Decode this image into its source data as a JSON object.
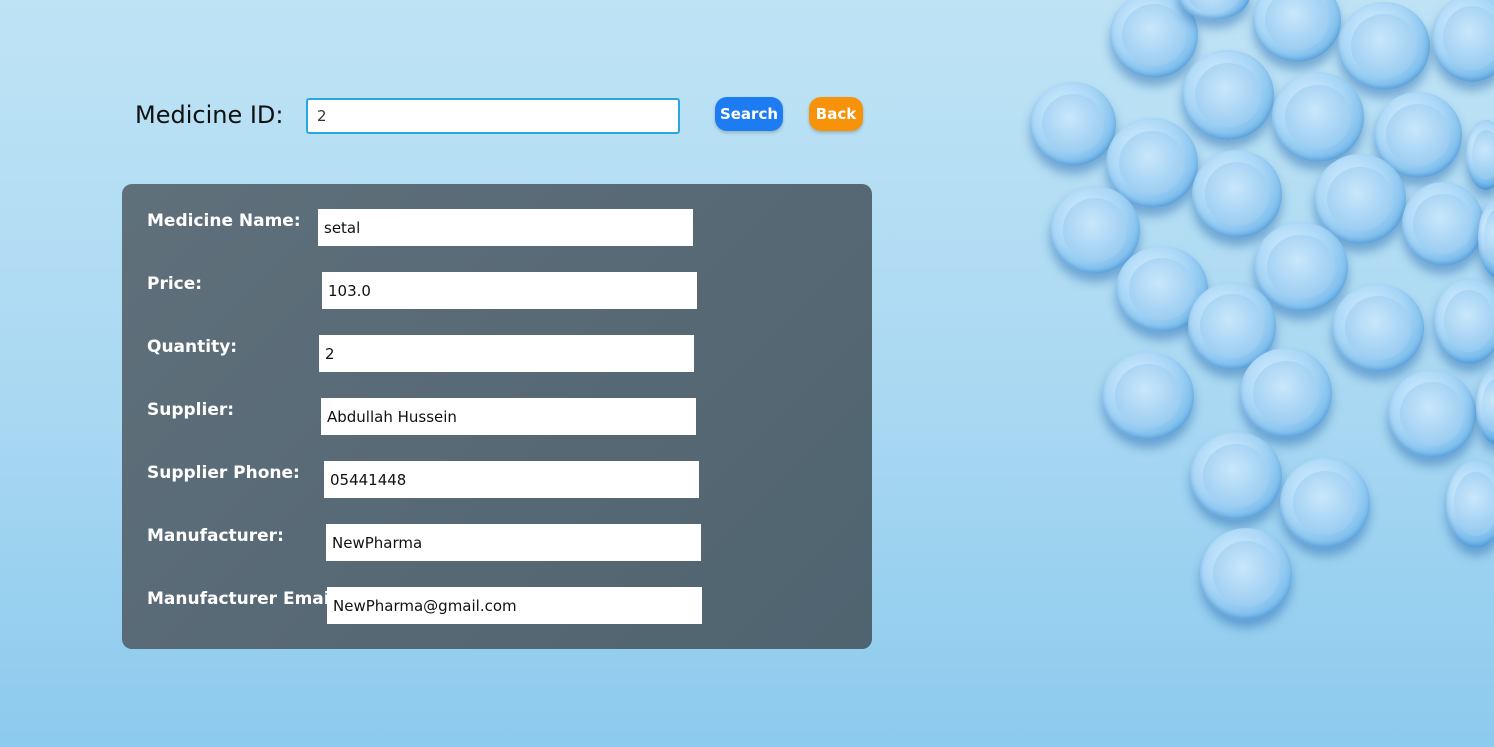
{
  "search": {
    "label": "Medicine ID:",
    "value": "2",
    "search_button": "Search",
    "back_button": "Back"
  },
  "details": {
    "name_label": "Medicine Name:",
    "name_value": "setal",
    "price_label": "Price:",
    "price_value": "103.0",
    "quantity_label": "Quantity:",
    "quantity_value": "2",
    "supplier_label": "Supplier:",
    "supplier_value": "Abdullah Hussein",
    "supplier_phone_label": "Supplier Phone:",
    "supplier_phone_value": "05441448",
    "manufacturer_label": "Manufacturer:",
    "manufacturer_value": "NewPharma",
    "manufacturer_email_label": "Manufacturer Email:",
    "manufacturer_email_value": "NewPharma@gmail.com"
  },
  "colors": {
    "search_button": "#1e7cf2",
    "back_button": "#f7930a",
    "panel": "#5a6b76",
    "input_border": "#2aa7e0"
  }
}
